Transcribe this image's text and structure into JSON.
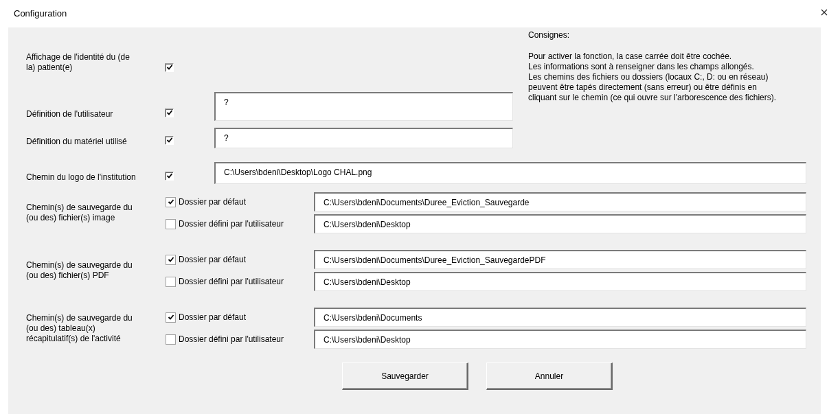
{
  "window": {
    "title": "Configuration"
  },
  "instructions": {
    "heading": "Consignes:",
    "lines": [
      "Pour activer la fonction, la case carrée doit être cochée.",
      "Les informations sont à renseigner dans les champs allongés.",
      "Les chemins des fichiers ou dossiers (locaux C:, D: ou en réseau)",
      "peuvent être tapés directement (sans erreur) ou être définis en",
      "cliquant sur le chemin (ce qui ouvre sur l'arborescence des fichiers)."
    ]
  },
  "settings": [
    {
      "kind": "check",
      "label": "Affichage de l'identité du (de la) patient(e)",
      "checked": true
    },
    {
      "kind": "field",
      "label": "Définition de l'utilisateur",
      "checked": true,
      "value": "?"
    },
    {
      "kind": "field",
      "label": "Définition du matériel utilisé",
      "checked": true,
      "value": "?"
    },
    {
      "kind": "wide-field",
      "label": "Chemin du logo de l'institution",
      "checked": true,
      "value": "C:\\Users\\bdeni\\Desktop\\Logo CHAL.png"
    }
  ],
  "save_paths": [
    {
      "label": "Chemin(s) de sauvegarde du (ou des) fichier(s) image",
      "options": [
        {
          "label": "Dossier par défaut",
          "checked": true,
          "value": "C:\\Users\\bdeni\\Documents\\Duree_Eviction_Sauvegarde"
        },
        {
          "label": "Dossier défini par l'utilisateur",
          "checked": false,
          "value": "C:\\Users\\bdeni\\Desktop"
        }
      ]
    },
    {
      "label": "Chemin(s) de sauvegarde du (ou des) fichier(s) PDF",
      "options": [
        {
          "label": "Dossier par défaut",
          "checked": true,
          "value": "C:\\Users\\bdeni\\Documents\\Duree_Eviction_SauvegardePDF"
        },
        {
          "label": "Dossier défini par l'utilisateur",
          "checked": false,
          "value": "C:\\Users\\bdeni\\Desktop"
        }
      ]
    },
    {
      "label": "Chemin(s) de sauvegarde du (ou des) tableau(x) récapitulatif(s) de l'activité",
      "options": [
        {
          "label": "Dossier par défaut",
          "checked": true,
          "value": "C:\\Users\\bdeni\\Documents"
        },
        {
          "label": "Dossier défini par l'utilisateur",
          "checked": false,
          "value": "C:\\Users\\bdeni\\Desktop"
        }
      ]
    }
  ],
  "buttons": [
    "Sauvegarder",
    "Annuler"
  ]
}
